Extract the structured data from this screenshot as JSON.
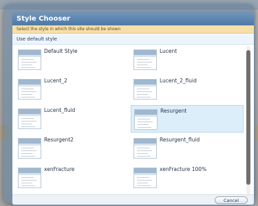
{
  "dialog": {
    "title": "Style Chooser",
    "notice": "Select the style in which this site should be shown",
    "default_style_label": "Use default style",
    "cancel_label": "Cancel"
  },
  "styles": [
    {
      "name": "Default Style",
      "selected": false
    },
    {
      "name": "Lucent",
      "selected": false
    },
    {
      "name": "Lucent_2",
      "selected": false
    },
    {
      "name": "Lucent_2_fluid",
      "selected": false
    },
    {
      "name": "Lucent_fluid",
      "selected": false
    },
    {
      "name": "Resurgent",
      "selected": true
    },
    {
      "name": "Resurgent2",
      "selected": false
    },
    {
      "name": "Resurgent_fluid",
      "selected": false
    },
    {
      "name": "xenFracture",
      "selected": false
    },
    {
      "name": "xenFracture 100%",
      "selected": false
    }
  ],
  "colors": {
    "title_bar": "#5a84b0",
    "notice_bg": "#f7dfa9",
    "selected_bg": "#ddeefb"
  }
}
